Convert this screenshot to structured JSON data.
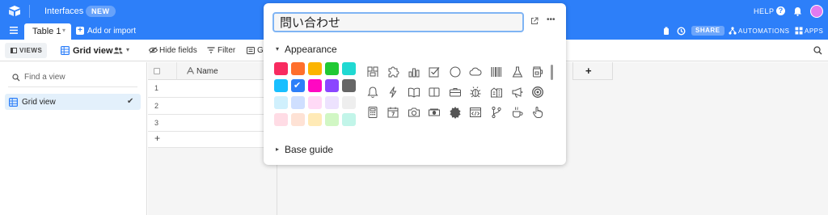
{
  "topbar": {
    "interfaces_label": "Interfaces",
    "new_badge": "NEW",
    "help_label": "HELP",
    "help_icon_glyph": "?"
  },
  "tabbar": {
    "table_tab_label": "Table 1",
    "table_tab_caret": "▾",
    "add_icon_glyph": "+",
    "add_or_import_label": "Add or import",
    "share_label": "SHARE",
    "automations_label": "AUTOMATIONS",
    "apps_label": "APPS"
  },
  "viewbar": {
    "views_label": "VIEWS",
    "current_view_label": "Grid view",
    "caret": "▾",
    "hide_fields_label": "Hide fields",
    "filter_label": "Filter",
    "group_label": "Gr"
  },
  "sidebar": {
    "find_placeholder": "Find a view",
    "views": [
      {
        "label": "Grid view",
        "check": "✔"
      }
    ]
  },
  "grid": {
    "primary_field_label": "Name",
    "add_field_glyph": "+",
    "add_row_glyph": "+",
    "rows": [
      "1",
      "2",
      "3"
    ]
  },
  "popover": {
    "name_value": "問い合わせ",
    "more_glyph": "•••",
    "appearance_caret": "▾",
    "appearance_label": "Appearance",
    "base_guide_caret": "▸",
    "base_guide_label": "Base guide",
    "selected_color": "#2d7ff9",
    "selected_tick": "✔",
    "colors": [
      "#f82b60",
      "#ff6f2c",
      "#fcb400",
      "#20c933",
      "#20d9d2",
      "#18bfff",
      "#2d7ff9",
      "#ff08c2",
      "#8b46ff",
      "#666666",
      "#d0f0fd",
      "#cfdfff",
      "#ffdaf6",
      "#ede2fe",
      "#eeeeee",
      "#ffdce5",
      "#fee2d5",
      "#ffeab6",
      "#d1f7c4",
      "#c2f5e9"
    ],
    "icons": [
      "kanji-icon",
      "puzzle-icon",
      "bar-chart-icon",
      "checkbox-icon",
      "circle-icon",
      "cloud-icon",
      "barcode-icon",
      "flask-icon",
      "jar-icon",
      "bell-icon",
      "lightning-icon",
      "book-open-icon",
      "book-icon",
      "briefcase-icon",
      "bug-icon",
      "buildings-icon",
      "megaphone-icon",
      "target-icon",
      "calculator-icon",
      "calendar-icon",
      "camera-icon",
      "money-icon",
      "badge-icon",
      "code-icon",
      "git-branch-icon",
      "coffee-icon",
      "hand-pointer-icon"
    ]
  }
}
